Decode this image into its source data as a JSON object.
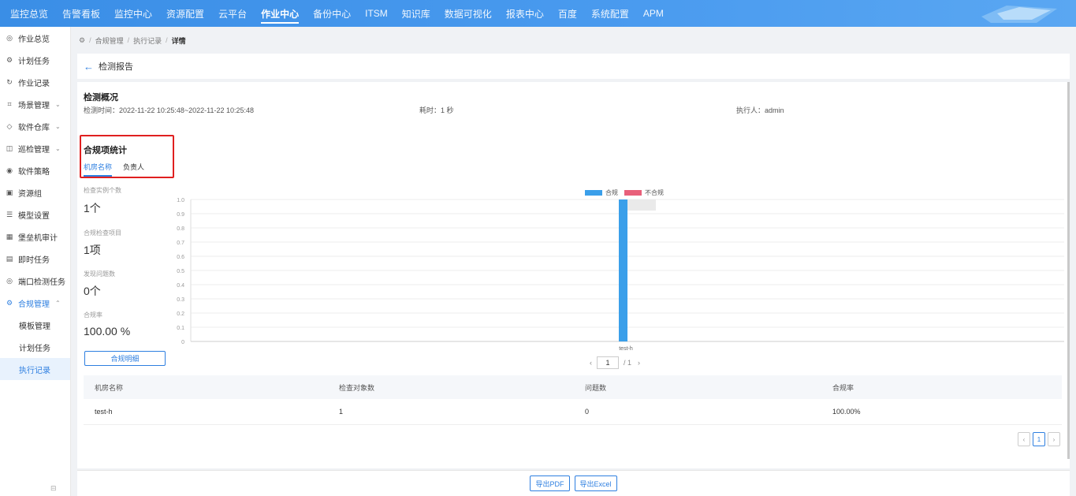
{
  "topnav": [
    {
      "label": "监控总览",
      "active": false
    },
    {
      "label": "告警看板",
      "active": false
    },
    {
      "label": "监控中心",
      "active": false
    },
    {
      "label": "资源配置",
      "active": false
    },
    {
      "label": "云平台",
      "active": false
    },
    {
      "label": "作业中心",
      "active": true
    },
    {
      "label": "备份中心",
      "active": false
    },
    {
      "label": "ITSM",
      "active": false
    },
    {
      "label": "知识库",
      "active": false
    },
    {
      "label": "数据可视化",
      "active": false
    },
    {
      "label": "报表中心",
      "active": false
    },
    {
      "label": "百度",
      "active": false
    },
    {
      "label": "系统配置",
      "active": false
    },
    {
      "label": "APM",
      "active": false
    }
  ],
  "sidebar": {
    "items": [
      {
        "label": "作业总览",
        "icon": "dashboard-icon",
        "glyph": "◎",
        "chevron": ""
      },
      {
        "label": "计划任务",
        "icon": "plan-icon",
        "glyph": "⚙",
        "chevron": ""
      },
      {
        "label": "作业记录",
        "icon": "history-icon",
        "glyph": "↻",
        "chevron": ""
      },
      {
        "label": "场景管理",
        "icon": "scene-icon",
        "glyph": "⌗",
        "chevron": "⌄"
      },
      {
        "label": "软件仓库",
        "icon": "software-icon",
        "glyph": "◇",
        "chevron": "⌄"
      },
      {
        "label": "巡检管理",
        "icon": "inspect-icon",
        "glyph": "◫",
        "chevron": "⌄"
      },
      {
        "label": "软件策略",
        "icon": "policy-icon",
        "glyph": "◉",
        "chevron": ""
      },
      {
        "label": "资源组",
        "icon": "resource-group-icon",
        "glyph": "▣",
        "chevron": ""
      },
      {
        "label": "模型设置",
        "icon": "model-icon",
        "glyph": "☰",
        "chevron": ""
      },
      {
        "label": "堡垒机审计",
        "icon": "audit-icon",
        "glyph": "▦",
        "chevron": ""
      },
      {
        "label": "即时任务",
        "icon": "instant-task-icon",
        "glyph": "▤",
        "chevron": ""
      },
      {
        "label": "端口检测任务",
        "icon": "port-check-icon",
        "glyph": "◎",
        "chevron": ""
      },
      {
        "label": "合规管理",
        "icon": "compliance-icon",
        "glyph": "⚙",
        "chevron": "⌃"
      }
    ],
    "subitems": [
      "模板管理",
      "计划任务",
      "执行记录"
    ],
    "active_sub": 2
  },
  "breadcrumb": {
    "home_icon": "gear-icon",
    "items": [
      "合规管理",
      "执行记录",
      "详情"
    ]
  },
  "header": {
    "title": "检测报告"
  },
  "overview": {
    "title": "检测概况",
    "time": "检测时间：2022-11-22 10:25:48~2022-11-22 10:25:48",
    "duration": "耗时：1 秒",
    "executor": "执行人：admin"
  },
  "stats": {
    "title": "合规项统计",
    "tabs": [
      "机房名称",
      "负责人"
    ],
    "active_tab": 0,
    "kpis": [
      {
        "label": "检查实例个数",
        "value": "1个"
      },
      {
        "label": "合规检查项目",
        "value": "1项"
      },
      {
        "label": "发现问题数",
        "value": "0个"
      },
      {
        "label": "合规率",
        "value": "100.00 %"
      }
    ],
    "detail_button": "合规明细"
  },
  "chart_data": {
    "type": "bar",
    "categories": [
      "test-h"
    ],
    "series": [
      {
        "name": "合规",
        "values": [
          1
        ],
        "color": "#3a9fea"
      },
      {
        "name": "不合规",
        "values": [
          0
        ],
        "color": "#e8607a"
      }
    ],
    "ylim": [
      0,
      1
    ],
    "yticks": [
      "0",
      "0.1",
      "0.2",
      "0.3",
      "0.4",
      "0.5",
      "0.6",
      "0.7",
      "0.8",
      "0.9",
      "1.0"
    ],
    "legend": "top-center"
  },
  "chart_pager": {
    "page": "1",
    "total": "/ 1"
  },
  "table": {
    "headers": [
      "机房名称",
      "检查对象数",
      "问题数",
      "合规率"
    ],
    "rows": [
      [
        "test-h",
        "1",
        "0",
        "100.00%"
      ]
    ]
  },
  "table_pager": {
    "page": "1"
  },
  "footer": {
    "export_pdf": "导出PDF",
    "export_excel": "导出Excel"
  }
}
